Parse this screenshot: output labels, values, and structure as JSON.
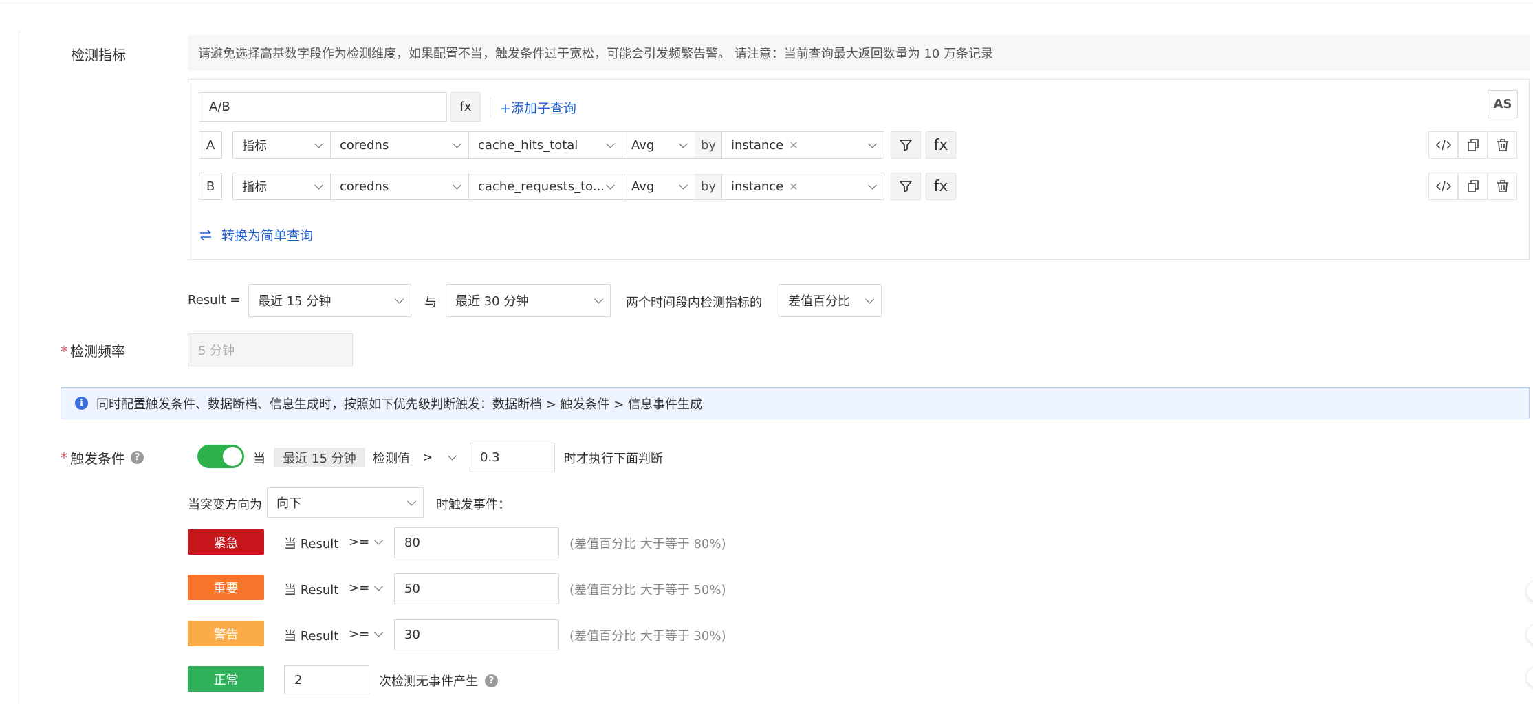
{
  "detection_metric": {
    "label": "检测指标",
    "hint": "请避免选择高基数字段作为检测维度，如果配置不当，触发条件过于宽松，可能会引发频繁告警。 请注意：当前查询最大返回数量为 10 万条记录",
    "expression_value": "A/B",
    "fx_label": "fx",
    "add_subquery": "+添加子查询",
    "as_label": "AS",
    "queries": [
      {
        "letter": "A",
        "type": "指标",
        "namespace": "coredns",
        "metric": "cache_hits_total",
        "agg": "Avg",
        "by": "by",
        "tag": "instance",
        "fx": "fx"
      },
      {
        "letter": "B",
        "type": "指标",
        "namespace": "coredns",
        "metric": "cache_requests_to...",
        "agg": "Avg",
        "by": "by",
        "tag": "instance",
        "fx": "fx"
      }
    ],
    "convert_link": "转换为简单查询"
  },
  "result": {
    "prefix": "Result =",
    "range1": "最近 15 分钟",
    "with": "与",
    "range2": "最近 30 分钟",
    "middle": "两个时间段内检测指标的",
    "compare": "差值百分比"
  },
  "frequency": {
    "label": "检测频率",
    "value": "5 分钟"
  },
  "alert_info": "同时配置触发条件、数据断档、信息生成时，按照如下优先级判断触发：数据断档 > 触发条件 > 信息事件生成",
  "trigger": {
    "label": "触发条件",
    "enabled": true,
    "when": "当",
    "range_chip": "最近 15 分钟",
    "check_value": "检测值",
    "operator": ">",
    "threshold": "0.3",
    "suffix": "时才执行下面判断",
    "direction_label": "当突变方向为",
    "direction_value": "向下",
    "direction_suffix": "时触发事件：",
    "levels": [
      {
        "badge": "紧急",
        "color": "#c8161d",
        "cond": "当 Result",
        "op": ">=",
        "value": "80",
        "note": "(差值百分比 大于等于 80%)"
      },
      {
        "badge": "重要",
        "color": "#f7742a",
        "cond": "当 Result",
        "op": ">=",
        "value": "50",
        "note": "(差值百分比 大于等于 50%)"
      },
      {
        "badge": "警告",
        "color": "#fbac49",
        "cond": "当 Result",
        "op": ">=",
        "value": "30",
        "note": "(差值百分比 大于等于 30%)"
      }
    ],
    "normal": {
      "badge": "正常",
      "color": "#2fb159",
      "count": "2",
      "suffix": "次检测无事件产生"
    }
  }
}
